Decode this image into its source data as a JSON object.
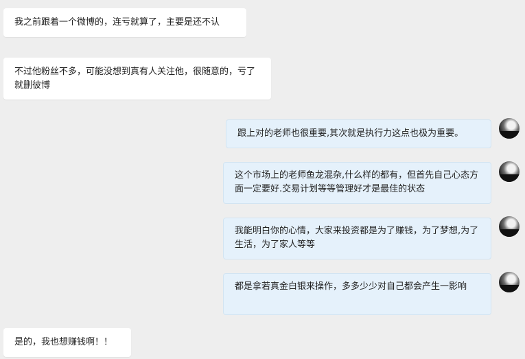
{
  "messages": [
    {
      "side": "left",
      "text": "我之前跟着一个微博的，连亏就算了，主要是还不认"
    },
    {
      "side": "left",
      "text": "不过他粉丝不多，可能没想到真有人关注他，很随意的，亏了就删彼博"
    },
    {
      "side": "right",
      "text": "跟上对的老师也很重要,其次就是执行力这点也极为重要。"
    },
    {
      "side": "right",
      "text": "这个市场上的老师鱼龙混杂,什么样的都有，但首先自己心态方面一定要好.交易计划等等管理好才是最佳的状态"
    },
    {
      "side": "right",
      "text": "我能明白你的心情，大家来投资都是为了赚钱，为了梦想,为了生活，为了家人等等"
    },
    {
      "side": "right",
      "text": "都是拿若真金白银来操作，多多少少对自己都会产生一影响"
    },
    {
      "side": "left",
      "text": "是的，我也想赚钱啊！！"
    }
  ],
  "avatar_icon": "user-avatar-icon"
}
